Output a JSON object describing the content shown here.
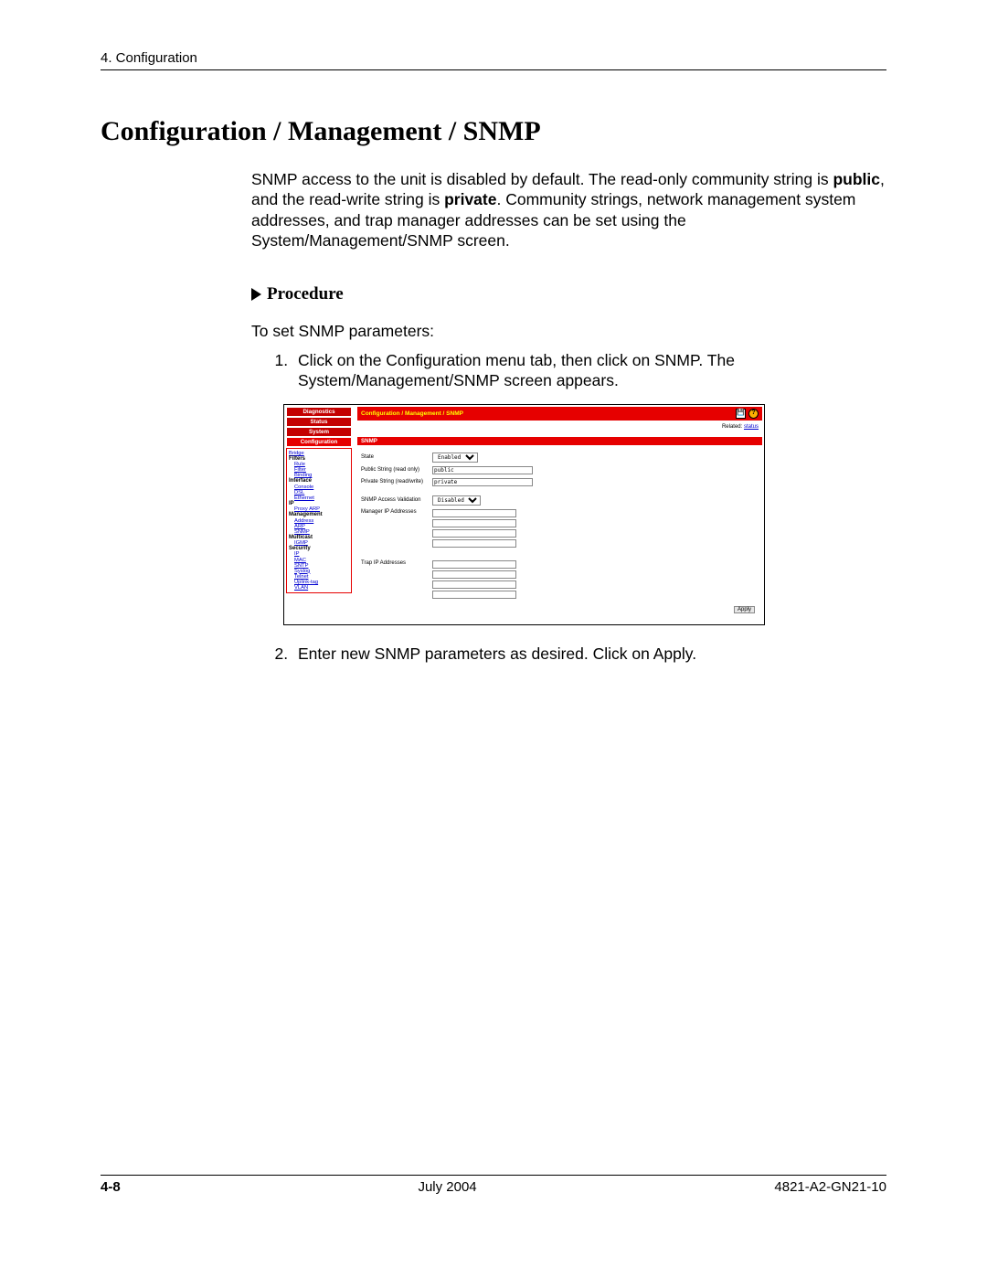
{
  "runningHead": "4. Configuration",
  "title": "Configuration / Management / SNMP",
  "intro_pre": "SNMP access to the unit is disabled by default. The read-only community string is ",
  "intro_b1": "public",
  "intro_mid": ", and the read-write string is ",
  "intro_b2": "private",
  "intro_post": ". Community strings, network management system addresses, and trap manager addresses can be set using the System/Management/SNMP screen.",
  "procedureLabel": "Procedure",
  "procedureIntro": "To set SNMP parameters:",
  "step1": "Click on the Configuration menu tab, then click on SNMP. The System/Management/SNMP screen appears.",
  "step2": "Enter new SNMP parameters as desired. Click on Apply.",
  "screenshot": {
    "sidebar": {
      "tabs": [
        "Diagnostics",
        "Status",
        "System",
        "Configuration"
      ],
      "groups": {
        "bridge": "Bridge",
        "filters": "Filters",
        "filters_items": [
          "Rule",
          "Filter",
          "Binding"
        ],
        "interface": "Interface",
        "interface_items": [
          "Console",
          "DSL",
          "Ethernet"
        ],
        "ip": "IP",
        "ip_items": [
          "Proxy ARP"
        ],
        "management": "Management",
        "management_items": [
          "Address",
          "ARP",
          "SNMP"
        ],
        "multicast": "Multicast",
        "multicast_items": [
          "IGMP"
        ],
        "security": "Security",
        "security_items": [
          "IP",
          "MAC",
          "SNTP",
          "Syslog",
          "Telnet",
          "Uplink-tag",
          "VLAN"
        ]
      }
    },
    "crumb": "Configuration / Management / SNMP",
    "relatedLabel": "Related:",
    "relatedLink": "status",
    "panelTitle": "SNMP",
    "fields": {
      "state": {
        "label": "State",
        "value": "Enabled"
      },
      "public": {
        "label": "Public String (read only)",
        "value": "public"
      },
      "private": {
        "label": "Private String (read/write)",
        "value": "private"
      },
      "access": {
        "label": "SNMP Access Validation",
        "value": "Disabled"
      },
      "managers": {
        "label": "Manager IP Addresses"
      },
      "traps": {
        "label": "Trap IP Addresses"
      }
    },
    "applyLabel": "Apply"
  },
  "footer": {
    "page": "4-8",
    "date": "July 2004",
    "doc": "4821-A2-GN21-10"
  }
}
